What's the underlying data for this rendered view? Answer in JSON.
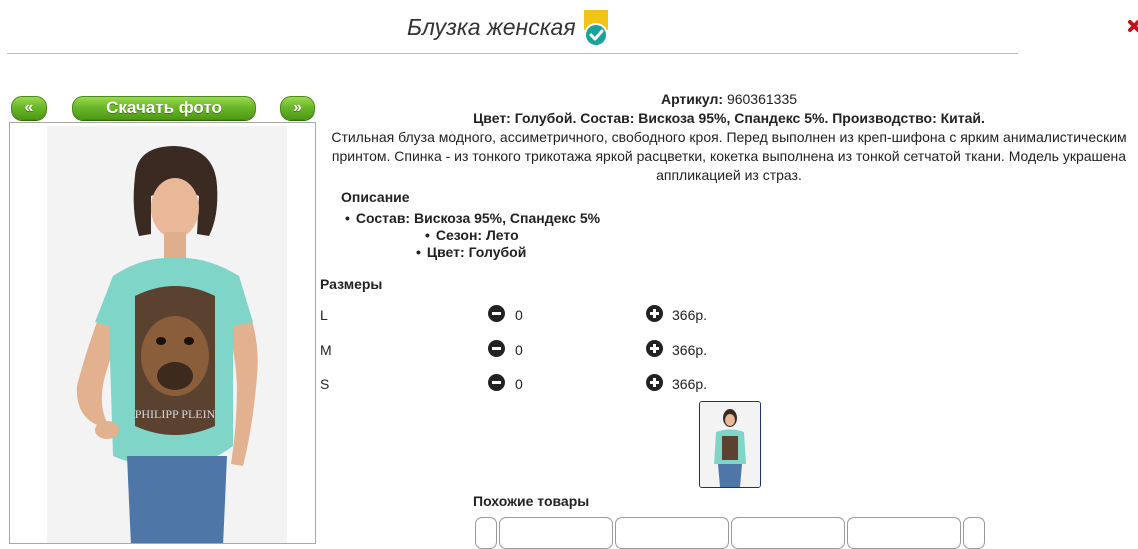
{
  "header": {
    "title": "Блузка женская",
    "badge_icon": "check-badge-icon"
  },
  "gallery": {
    "prev_label": "«",
    "download_label": "Скачать фото",
    "next_label": "»"
  },
  "product": {
    "article_label": "Артикул:",
    "article_value": "960361335",
    "spec_line": "Цвет: Голубой. Состав: Вискоза 95%, Спандекс 5%. Производство: Китай.",
    "description": "Стильная блуза модного, ассиметричного, свободного кроя. Перед выполнен из креп-шифона с ярким анималистическим принтом. Спинка - из тонкого трикотажа яркой расцветки, кокетка выполнена из тонкой сетчатой ткани. Модель украшена аппликацией из страз.",
    "details_heading": "Описание",
    "details": [
      "Состав: Вискоза 95%, Спандекс 5%",
      "Сезон: Лето",
      "Цвет: Голубой"
    ],
    "sizes_heading": "Размеры",
    "sizes": [
      {
        "size": "L",
        "qty": "0",
        "price": "366р."
      },
      {
        "size": "M",
        "qty": "0",
        "price": "366р."
      },
      {
        "size": "S",
        "qty": "0",
        "price": "366р."
      }
    ],
    "similar_heading": "Похожие товары"
  },
  "colors": {
    "button_green": "#6cb82a",
    "shirt_mint": "#7fd6c8",
    "badge_yellow": "#f2c417",
    "badge_teal": "#1aa39a"
  }
}
